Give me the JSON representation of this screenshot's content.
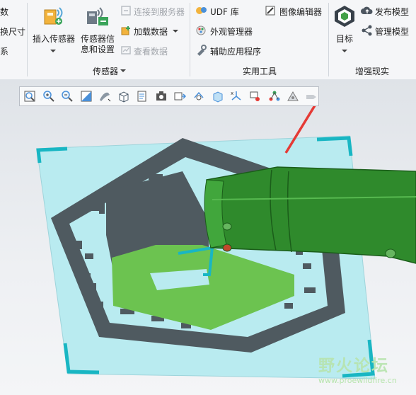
{
  "ribbon": {
    "left_cut": {
      "item1": "数",
      "item2": "换尺寸",
      "item3": "系"
    },
    "sensors": {
      "insert_sensor": "插入传感器",
      "sensor_info_line1": "传感器信",
      "sensor_info_line2": "息和设置",
      "connect_server": "连接到服务器",
      "load_data": "加载数据",
      "view_data": "查看数据",
      "group_label": "传感器"
    },
    "tools": {
      "udf": "UDF 库",
      "appearance": "外观管理器",
      "aux_app": "辅助应用程序",
      "image_editor": "图像编辑器",
      "group_label": "实用工具"
    },
    "ar": {
      "target": "目标",
      "publish": "发布模型",
      "manage": "管理模型",
      "group_label": "增强现实"
    }
  },
  "view_toolbar": {
    "buttons": [
      "zoom-fit",
      "zoom-in",
      "zoom-out",
      "repaint",
      "display-style",
      "saved-orientations",
      "view-manager",
      "perspective",
      "datum-display",
      "spin-center",
      "annotation",
      "section",
      "color",
      "render",
      "explode"
    ]
  },
  "watermark": {
    "text": "野火论坛",
    "url": "www.proewildfire.cn"
  },
  "colors": {
    "accent_red": "#e53a35",
    "marker_cyan": "#19b6c3",
    "model_green": "#3f9a3c"
  }
}
